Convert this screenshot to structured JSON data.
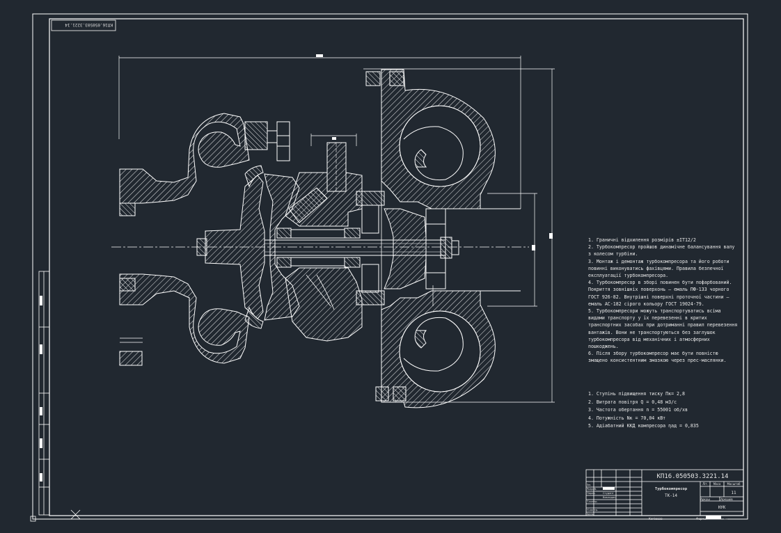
{
  "window": {
    "background": "#212830",
    "line_color": "#ffffff"
  },
  "stamp": {
    "code_mirrored": "КП16.050503.3221.14"
  },
  "dimensions": {
    "top_label": "▬",
    "shaft_label": "▬",
    "right_label_1": "▮",
    "right_label_2": "▮"
  },
  "notes": [
    "1. Граничні відхилення розмірів ±IT12/2",
    "2. Турбокомпресор пройшов динамічне балансування валу з колесом турбіни.",
    "3. Монтаж і демонтаж турбокомпресора та його роботи повинні виконуватись фахівцями. Правила безпечної експлуатації турбокомпресора.",
    "4. Турбокомпресор в зборі повинен бути пофарбований. Покриття зовнішніх поверхонь – емаль ПФ-133 чорного ГОСТ 926-82. Внутрішні поверхні проточної частини – емаль АС-182 сірого кольору ГОСТ 19024-79.",
    "5. Турбокомпресори можуть транспортуватись всіма видами транспорту у їх перевезенні в критих транспортних засобах при дотриманні правил перевезення вантажів. Вони не транспортуються без заглушок турбокомпресора від механічних і атмосферних пошкоджень.",
    "6. Після збору турбокомпресор має бути повністю змащено консистентним змазкою через прес-маслянки."
  ],
  "tech_specs": [
    "1. Ступінь підвищення тиску Пк= 2,8",
    "2. Витрата повітря Q = 0,48 м3/с",
    "3. Частота обертання n = 55001 об/хв",
    "4. Потужність Nк = 70,04 кВт",
    "5. Адіабатний ККД компресора ηад = 0,835"
  ],
  "title_block": {
    "doc_code": "КП16.050503.3221.14",
    "product_name": "Турбокомпресор",
    "product_model": "ТК-14",
    "sheet_count": "11",
    "organization": "НУК",
    "col_lit": "Літ.",
    "col_mass": "Маса",
    "col_scale": "Масштаб",
    "col_sheet": "Аркуш",
    "col_sheets": "Аркушів",
    "copied": "Копіював",
    "format": "Формат",
    "format_value": "А1",
    "rows": [
      {
        "role": "Зм.",
        "name": "",
        "sign": "",
        "date": ""
      },
      {
        "role": "Розроб.",
        "name": "Студент",
        "sign": "",
        "date": ""
      },
      {
        "role": "Перев.",
        "name": "Викладач",
        "sign": "",
        "date": ""
      },
      {
        "role": "Т.контр.",
        "name": "",
        "sign": "",
        "date": ""
      },
      {
        "role": "Н.контр.",
        "name": "",
        "sign": "",
        "date": ""
      },
      {
        "role": "Затв.",
        "name": "",
        "sign": "",
        "date": ""
      }
    ]
  }
}
